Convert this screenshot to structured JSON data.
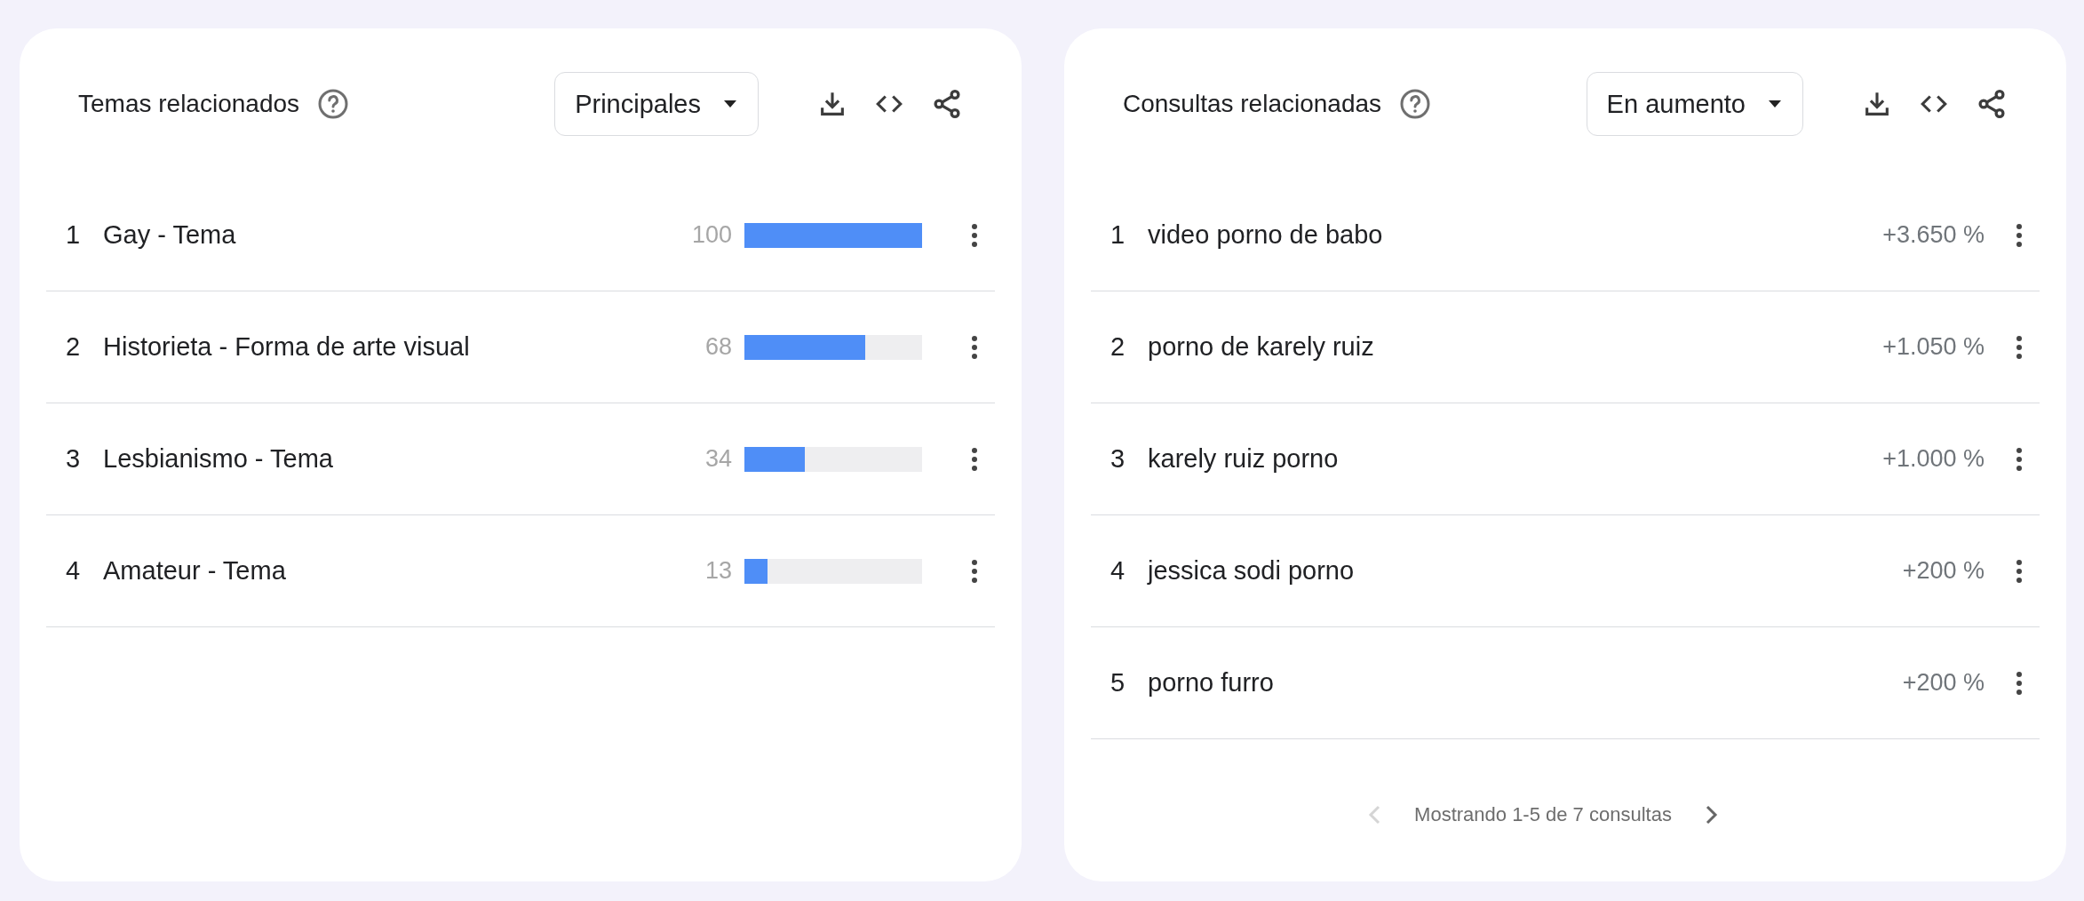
{
  "cards": [
    {
      "title": "Temas relacionados",
      "dropdown": {
        "value": "Principales"
      },
      "rows": [
        {
          "rank": "1",
          "label": "Gay - Tema",
          "value": "100",
          "level": 1.0
        },
        {
          "rank": "2",
          "label": "Historieta - Forma de arte visual",
          "value": "68",
          "level": 0.68
        },
        {
          "rank": "3",
          "label": "Lesbianismo - Tema",
          "value": "34",
          "level": 0.34
        },
        {
          "rank": "4",
          "label": "Amateur - Tema",
          "value": "13",
          "level": 0.13
        }
      ]
    },
    {
      "title": "Consultas relacionadas",
      "dropdown": {
        "value": "En aumento"
      },
      "rows": [
        {
          "rank": "1",
          "label": "video porno de babo",
          "value": "+3.650 %"
        },
        {
          "rank": "2",
          "label": "porno de karely ruiz",
          "value": "+1.050 %"
        },
        {
          "rank": "3",
          "label": "karely ruiz porno",
          "value": "+1.000 %"
        },
        {
          "rank": "4",
          "label": "jessica sodi porno",
          "value": "+200 %"
        },
        {
          "rank": "5",
          "label": "porno furro",
          "value": "+200 %"
        }
      ],
      "pagination": {
        "text": "Mostrando 1-5 de 7 consultas",
        "prev_disabled": true,
        "next_disabled": false
      }
    }
  ]
}
